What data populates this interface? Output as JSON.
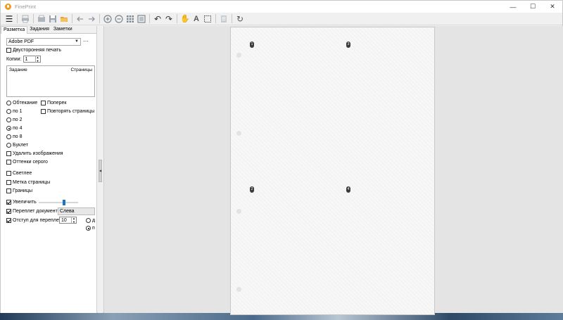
{
  "window": {
    "title": "FinePrint",
    "minimize": "—",
    "maximize": "☐",
    "close": "✕"
  },
  "toolbar": {
    "menu": "☰",
    "undo": "↶",
    "redo": "↷",
    "refresh": "↻",
    "text_tool": "A"
  },
  "tabs": [
    {
      "label": "Разметка",
      "active": true
    },
    {
      "label": "Задания",
      "active": false
    },
    {
      "label": "Заметки",
      "active": false
    }
  ],
  "printer": {
    "selected": "Adobe PDF",
    "more": "···"
  },
  "duplex": {
    "label": "Двусторонняя печать",
    "checked": false
  },
  "copies": {
    "label": "Копии:",
    "value": "1"
  },
  "jobs": {
    "col_job": "Задание",
    "col_pages": "Страницы"
  },
  "layout": {
    "wrap": "Обтекание",
    "across": "Поперек",
    "repeat_pages": "Повторять страницы",
    "n1": "по 1",
    "n2": "по 2",
    "n4": "по 4",
    "n8": "по 8",
    "booklet": "Буклет",
    "selected": "по 4"
  },
  "options": {
    "remove_images": "Удалить изображения",
    "grayscale": "Оттенки серого",
    "lighter": "Светлее",
    "page_label": "Метка страницы",
    "borders": "Границы",
    "zoom": "Увеличить",
    "zoom_level_fraction": 0.65,
    "binding": "Переплет документа",
    "binding_value": "Слева",
    "gutter": "Отступ для переплета",
    "gutter_value": "10",
    "gutter_radio_1": "д",
    "gutter_radio_2": "п"
  },
  "preview": {
    "page_numbers": [
      "1",
      "3",
      "2",
      "4"
    ]
  }
}
